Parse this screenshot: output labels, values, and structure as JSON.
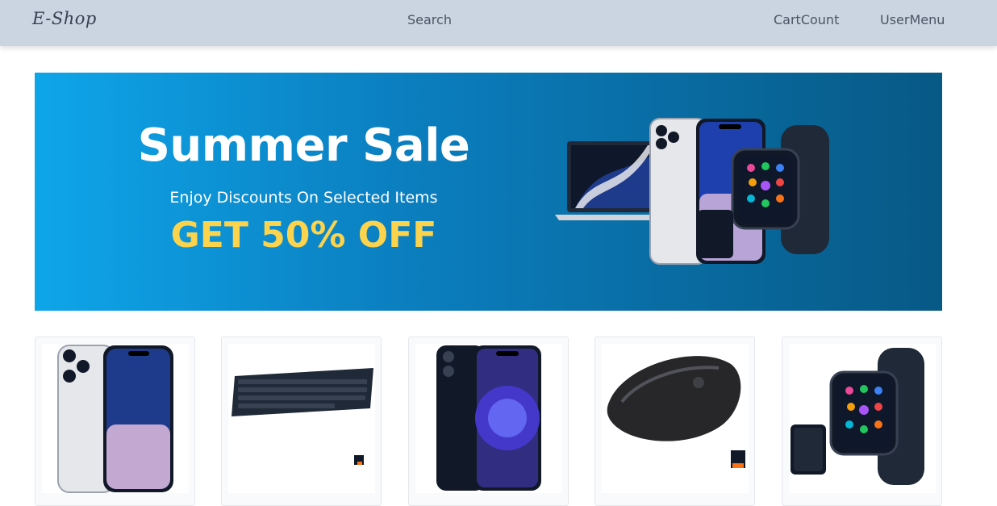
{
  "navbar": {
    "logo": "E-Shop",
    "search_label": "Search",
    "cart_label": "CartCount",
    "user_label": "UserMenu"
  },
  "banner": {
    "title": "Summer Sale",
    "subtitle": "Enjoy Discounts On Selected Items",
    "offer": "GET 50% OFF",
    "colors": {
      "gradient_start": "#0ea5e9",
      "gradient_end": "#075985",
      "offer": "#fcd34d"
    }
  },
  "products": [
    {
      "icon": "smartphone-white-icon"
    },
    {
      "icon": "keyboard-icon"
    },
    {
      "icon": "smartphone-black-icon"
    },
    {
      "icon": "mouse-icon"
    },
    {
      "icon": "smartwatch-icon"
    }
  ]
}
